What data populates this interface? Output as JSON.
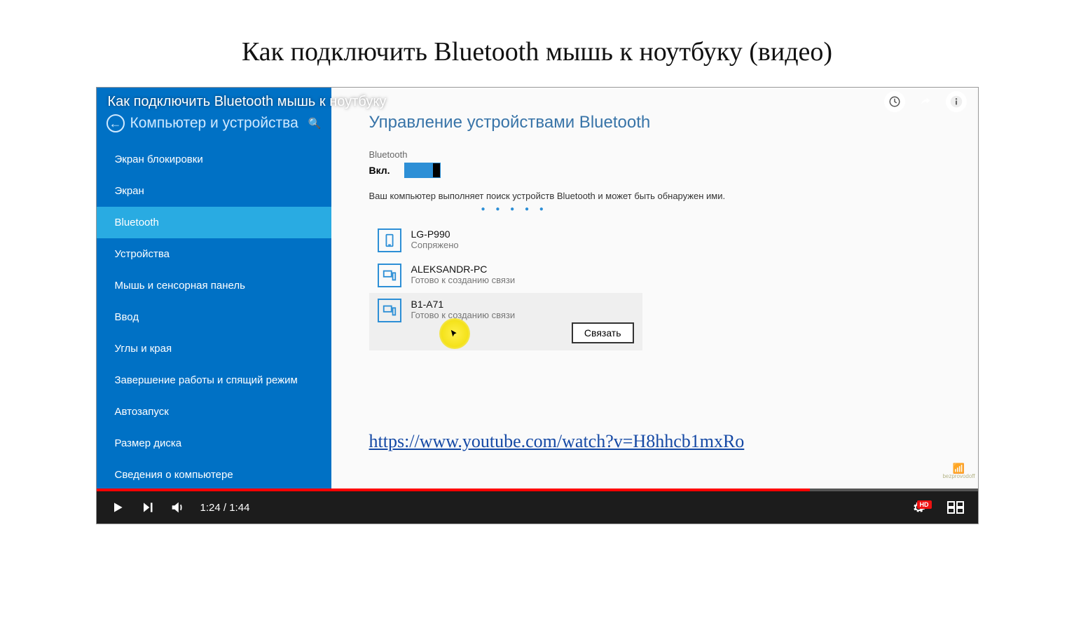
{
  "page_title": "Как подключить Bluetooth мышь к ноутбуку (видео)",
  "video": {
    "overlay_title": "Как подключить Bluetooth мышь к ноутбуку",
    "time_current": "1:24",
    "time_total": "1:44",
    "progress_percent": 81,
    "hd_label": "HD"
  },
  "sidebar": {
    "header": "Компьютер и устройства",
    "items": [
      {
        "label": "Экран блокировки",
        "active": false
      },
      {
        "label": "Экран",
        "active": false
      },
      {
        "label": "Bluetooth",
        "active": true
      },
      {
        "label": "Устройства",
        "active": false
      },
      {
        "label": "Мышь и сенсорная панель",
        "active": false
      },
      {
        "label": "Ввод",
        "active": false
      },
      {
        "label": "Углы и края",
        "active": false
      },
      {
        "label": "Завершение работы и спящий режим",
        "active": false
      },
      {
        "label": "Автозапуск",
        "active": false
      },
      {
        "label": "Размер диска",
        "active": false
      },
      {
        "label": "Сведения о компьютере",
        "active": false
      }
    ]
  },
  "content": {
    "title": "Управление устройствами Bluetooth",
    "bt_label": "Bluetooth",
    "bt_state": "Вкл.",
    "scan_text": "Ваш компьютер выполняет поиск устройств Bluetooth и может быть обнаружен ими.",
    "devices": [
      {
        "name": "LG-P990",
        "status": "Сопряжено",
        "icon": "phone",
        "selected": false
      },
      {
        "name": "ALEKSANDR-PC",
        "status": "Готово к созданию связи",
        "icon": "pc",
        "selected": false
      },
      {
        "name": "B1-A71",
        "status": "Готово к созданию связи",
        "icon": "pc",
        "selected": true
      }
    ],
    "pair_button": "Связать",
    "link_text": "https://www.youtube.com/watch?v=H8hhcb1mxRo",
    "watermark_text": "bezprovodoff"
  }
}
